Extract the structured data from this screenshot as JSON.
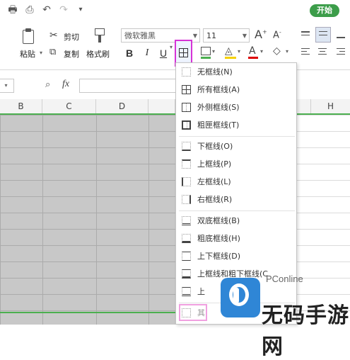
{
  "quickbar": {
    "start_button": "开始",
    "icons": [
      "print-icon",
      "print-preview-icon",
      "undo-icon",
      "redo-icon",
      "customize-arrow-icon"
    ]
  },
  "ribbon": {
    "paste_label": "粘贴",
    "cut_label": "剪切",
    "copy_label": "复制",
    "format_painter_label": "格式刷",
    "font_name": "微软雅黑",
    "font_size": "11",
    "bold": "B",
    "italic": "I",
    "underline": "U",
    "grow_font": "A",
    "shrink_font": "A",
    "font_color": "A"
  },
  "formula_bar": {
    "fx": "fx"
  },
  "columns": [
    "B",
    "C",
    "D",
    "H"
  ],
  "border_menu": {
    "items": [
      {
        "label": "无框线(N)",
        "icon": "no-border-icon"
      },
      {
        "label": "所有框线(A)",
        "icon": "all-borders-icon"
      },
      {
        "label": "外侧框线(S)",
        "icon": "outside-borders-icon"
      },
      {
        "label": "粗匣框线(T)",
        "icon": "thick-box-border-icon"
      },
      {
        "label": "下框线(O)",
        "icon": "bottom-border-icon"
      },
      {
        "label": "上框线(P)",
        "icon": "top-border-icon"
      },
      {
        "label": "左框线(L)",
        "icon": "left-border-icon"
      },
      {
        "label": "右框线(R)",
        "icon": "right-border-icon"
      },
      {
        "label": "双底框线(B)",
        "icon": "double-bottom-border-icon"
      },
      {
        "label": "粗底框线(H)",
        "icon": "thick-bottom-border-icon"
      },
      {
        "label": "上下框线(D)",
        "icon": "top-bottom-border-icon"
      },
      {
        "label": "上框线和粗下框线(C",
        "icon": "top-thick-bottom-border-icon"
      },
      {
        "label": "上",
        "icon": "top-double-bottom-border-icon"
      },
      {
        "label": "其",
        "icon": "other-borders-icon"
      }
    ]
  },
  "watermark": {
    "brand": "PConline",
    "text": "无码手游网"
  }
}
